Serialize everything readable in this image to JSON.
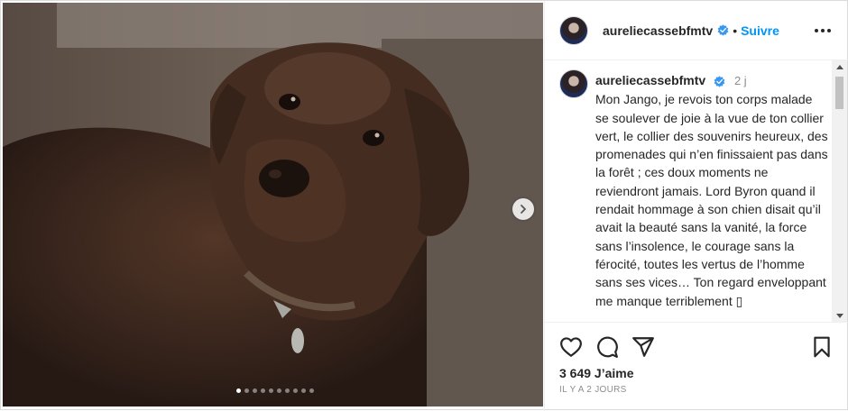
{
  "post": {
    "username": "aureliecassebfmtv",
    "follow_label": "Suivre",
    "caption": {
      "username": "aureliecassebfmtv",
      "time": "2 j",
      "text": "Mon Jango, je revois ton corps malade se soulever de joie à la vue de ton collier vert, le collier des souvenirs heureux, des promenades qui n’en finissaient pas dans la forêt ; ces doux moments ne reviendront jamais. Lord Byron quand il rendait hommage à son chien disait qu’il avait la beauté sans la vanité, la force sans l’insolence, le courage sans la férocité, toutes les vertus de l’homme sans ses vices… Ton regard enveloppant me manque terriblement ▯"
    },
    "likes": "3 649 J’aime",
    "time_ago": "IL Y A 2 JOURS",
    "carousel": {
      "total": 10,
      "active": 1
    }
  },
  "icons": {
    "verified": "verified-badge-icon",
    "more": "more-options-icon",
    "next": "chevron-right-icon",
    "like": "heart-icon",
    "comment": "comment-icon",
    "share": "paper-plane-icon",
    "save": "bookmark-icon"
  },
  "colors": {
    "accent": "#0095f6",
    "text": "#262626",
    "muted": "#8e8e8e",
    "verified": "#3897f0"
  }
}
